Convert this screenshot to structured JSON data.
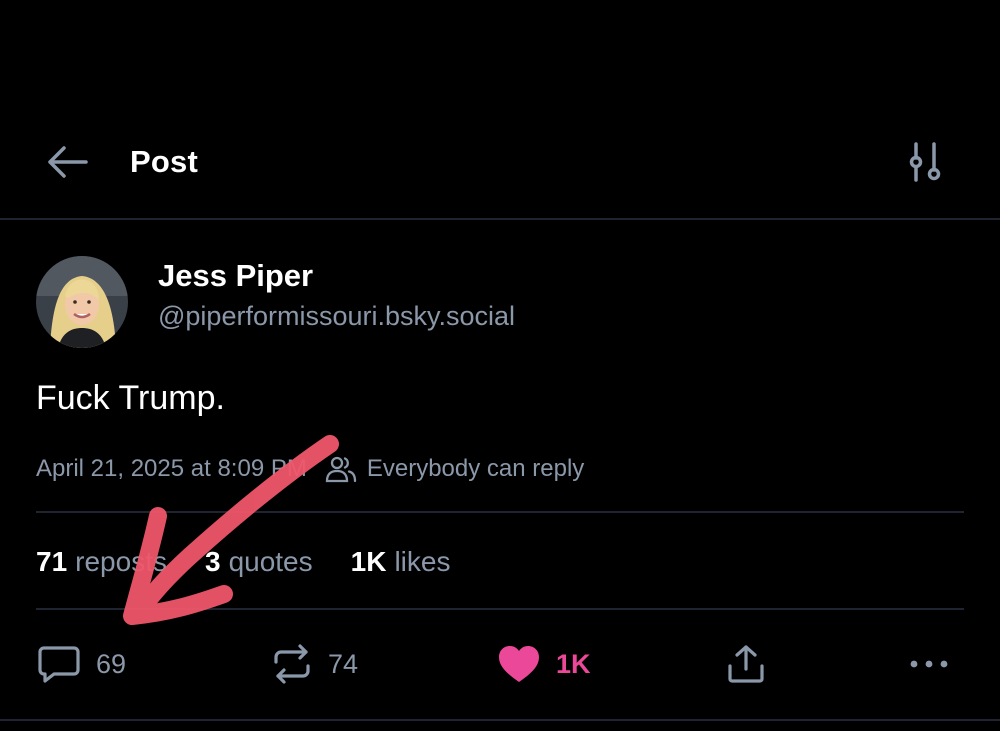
{
  "header": {
    "title": "Post",
    "back_icon": "arrow-left-icon",
    "filter_icon": "sliders-icon"
  },
  "post": {
    "author_name": "Jess Piper",
    "author_handle": "@piperformissouri.bsky.social",
    "text": "Fuck Trump.",
    "timestamp": "April 21, 2025 at 8:09 PM",
    "reply_setting": "Everybody can reply"
  },
  "stats": {
    "reposts_count": "71",
    "reposts_label": "reposts",
    "quotes_count": "3",
    "quotes_label": "quotes",
    "likes_count": "1K",
    "likes_label": "likes"
  },
  "actions": {
    "reply_count": "69",
    "repost_count": "74",
    "like_count": "1K"
  },
  "colors": {
    "background": "#000000",
    "muted_text": "#8b98a9",
    "like_accent": "#ec4899",
    "annotation_arrow": "#f0566a"
  }
}
